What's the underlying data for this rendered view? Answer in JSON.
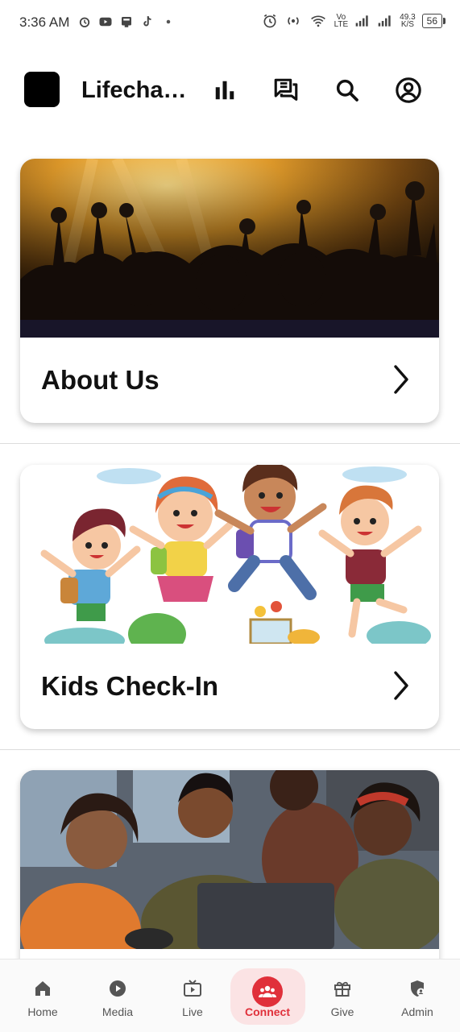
{
  "status_bar": {
    "time": "3:36 AM",
    "net_speed_value": "49.3",
    "net_speed_unit": "K/S",
    "net_type_top": "Vo",
    "net_type_bottom": "LTE",
    "battery": "56"
  },
  "header": {
    "title": "Lifechan...",
    "icons": [
      "bar-chart-icon",
      "chat-icon",
      "search-icon",
      "account-icon"
    ]
  },
  "cards": [
    {
      "label": "About Us"
    },
    {
      "label": "Kids Check-In"
    },
    {
      "label": ""
    }
  ],
  "bottom_nav": {
    "items": [
      {
        "label": "Home",
        "icon": "home-icon"
      },
      {
        "label": "Media",
        "icon": "play-icon"
      },
      {
        "label": "Live",
        "icon": "tv-icon"
      },
      {
        "label": "Connect",
        "icon": "group-icon",
        "active": true
      },
      {
        "label": "Give",
        "icon": "gift-icon"
      },
      {
        "label": "Admin",
        "icon": "admin-shield-icon"
      }
    ]
  },
  "colors": {
    "accent": "#e0303a",
    "accent_bg": "#fbe3e4"
  }
}
